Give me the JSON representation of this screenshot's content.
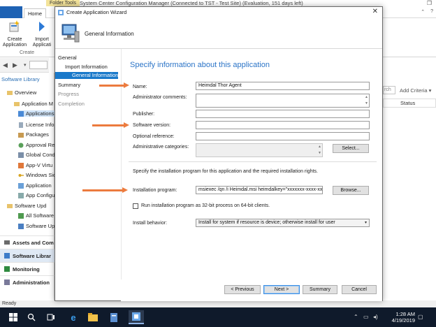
{
  "background_app": {
    "title": "System Center Configuration Manager (Connected to TST - Test Site) (Evaluation, 151 days left)",
    "folder_tools": "Folder Tools",
    "tabs": {
      "home": "Home"
    },
    "ribbon": {
      "create_application": "Create Application",
      "import_application": "Import Applicati",
      "group_label": "Create"
    },
    "sidebar": {
      "header": "Software Library",
      "tree": [
        "Overview",
        "Application M",
        "Applications",
        "License Info",
        "Packages",
        "Approval Re",
        "Global Cond",
        "App-V Virtu",
        "Windows Sid",
        "Application",
        "App Configu",
        "Software Upd",
        "All Software",
        "Software Up"
      ],
      "workspaces": [
        "Assets and Com",
        "Software Librar",
        "Monitoring",
        "Administration"
      ]
    },
    "right_pane": {
      "search": "rch",
      "add_criteria": "Add Criteria ▾",
      "column_status": "Status"
    },
    "statusbar": "Ready",
    "taskbar": {
      "time": "1:28 AM",
      "date": "4/19/2019"
    }
  },
  "wizard": {
    "title": "Create Application Wizard",
    "header": "General Information",
    "steps": {
      "general": "General",
      "import_information": "Import Information",
      "general_information": "General Information",
      "summary": "Summary",
      "progress": "Progress",
      "completion": "Completion"
    },
    "page_title": "Specify information about this application",
    "fields": {
      "name_label": "Name:",
      "name_value": "Heimdal Thor Agent",
      "admin_comments_label": "Administrator comments:",
      "publisher_label": "Publisher:",
      "software_version_label": "Software version:",
      "optional_reference_label": "Optional reference:",
      "admin_categories_label": "Administrative categories:",
      "select_button": "Select...",
      "install_info": "Specify the installation program for this application and the required installation rights.",
      "install_program_label": "Installation program:",
      "install_program_value": "msiexec /qn /i Heimdal.msi heimdalkey=\"xxxxxxx-xxxx-xxxx-xxx",
      "browse_button": "Browse...",
      "run_32bit_label": "Run installation program as 32-bit process on 64-bit clients.",
      "install_behavior_label": "Install behavior:",
      "install_behavior_value": "Install for system if resource is device; otherwise install for user"
    },
    "buttons": {
      "previous": "< Previous",
      "next": "Next >",
      "summary": "Summary",
      "cancel": "Cancel"
    }
  },
  "colors": {
    "accent": "#1979ca",
    "page_title": "#2b74c7",
    "arrow": "#ec7b3e",
    "taskbar": "#0f1a2b"
  }
}
